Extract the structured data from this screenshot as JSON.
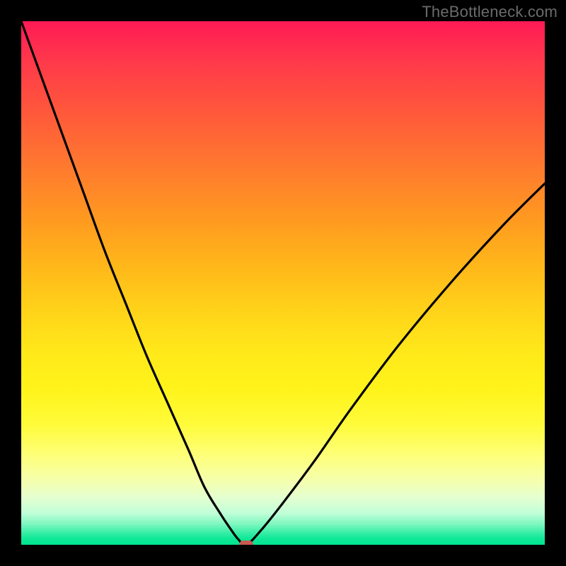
{
  "watermark": "TheBottleneck.com",
  "chart_data": {
    "type": "line",
    "title": "",
    "xlabel": "",
    "ylabel": "",
    "xlim": [
      0,
      100
    ],
    "ylim": [
      0,
      100
    ],
    "grid": false,
    "legend": false,
    "background_gradient": {
      "top_color": "#ff1a55",
      "mid_color": "#ffe81a",
      "bottom_color": "#00e48f"
    },
    "series": [
      {
        "name": "bottleneck-curve",
        "color": "#000000",
        "x": [
          0,
          4,
          8,
          12,
          16,
          20,
          24,
          28,
          32,
          35,
          38,
          40,
          41.5,
          43,
          46,
          50,
          56,
          63,
          72,
          82,
          92,
          100
        ],
        "y": [
          100,
          89,
          78,
          67,
          56,
          46,
          36,
          27,
          18,
          11,
          6,
          3,
          1,
          0,
          3,
          8,
          16,
          26,
          38,
          50,
          61,
          69
        ]
      }
    ],
    "marker": {
      "name": "optimal-point",
      "x": 43,
      "y": 0,
      "color": "#c85a50"
    }
  }
}
